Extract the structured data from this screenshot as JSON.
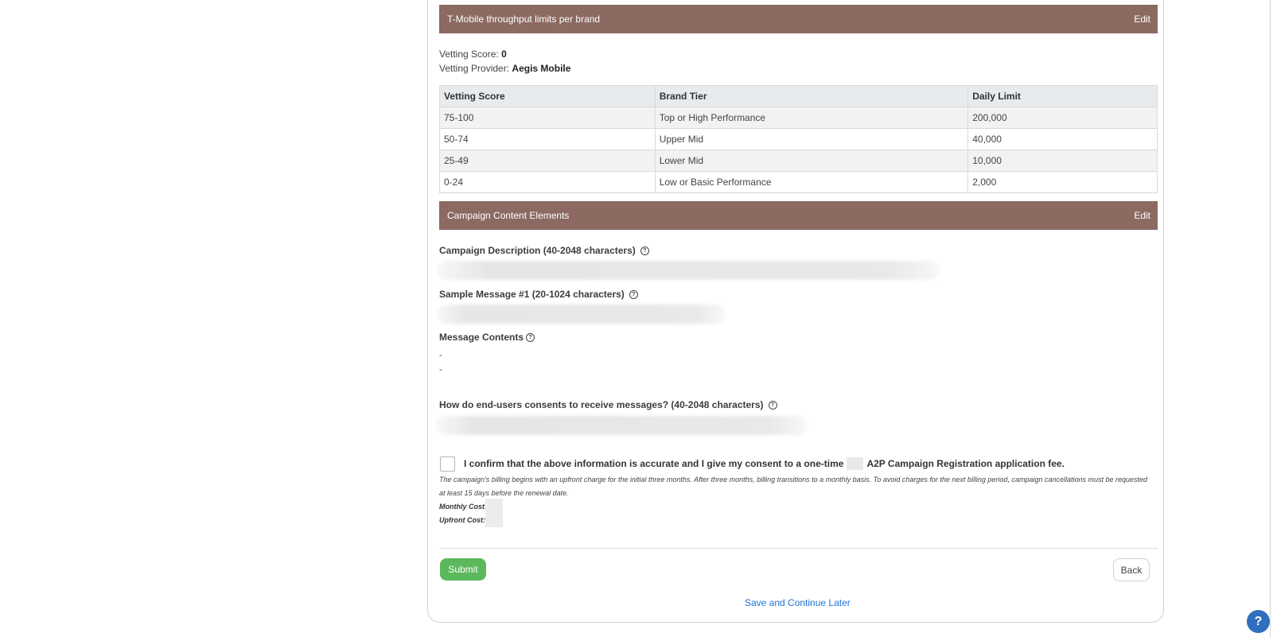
{
  "tmobile": {
    "title": "T-Mobile throughput limits per brand",
    "edit_label": "Edit",
    "vetting_score_label": "Vetting Score:",
    "vetting_score_value": "0",
    "vetting_provider_label": "Vetting Provider:",
    "vetting_provider_value": "Aegis Mobile",
    "columns": [
      "Vetting Score",
      "Brand Tier",
      "Daily Limit"
    ],
    "rows": [
      [
        "75-100",
        "Top or High Performance",
        "200,000"
      ],
      [
        "50-74",
        "Upper Mid",
        "40,000"
      ],
      [
        "25-49",
        "Lower Mid",
        "10,000"
      ],
      [
        "0-24",
        "Low or Basic Performance",
        "2,000"
      ]
    ]
  },
  "content": {
    "title": "Campaign Content Elements",
    "edit_label": "Edit",
    "description_label": "Campaign Description (40-2048 characters)",
    "sample_label": "Sample Message #1 (20-1024 characters)",
    "message_contents_label": "Message Contents",
    "message_contents_items": [
      "-",
      "-"
    ],
    "consent_question_label": "How do end-users consents to receive messages? (40-2048 characters)"
  },
  "confirm": {
    "text_before": "I confirm that the above information is accurate and I give my consent to a one-time",
    "text_after": "A2P Campaign Registration application fee.",
    "billing_note": "The campaign's billing begins with an upfront charge for the initial three months. After three months, billing transitions to a monthly basis. To avoid charges for the next billing period, campaign cancellations must be requested at least 15 days before the renewal date.",
    "monthly_cost_label": "Monthly Cost:",
    "upfront_cost_label": "Upfront Cost:"
  },
  "actions": {
    "submit_label": "Submit",
    "back_label": "Back",
    "save_later_label": "Save and Continue Later"
  },
  "icons": {
    "help": "question-circle-icon",
    "support": "chat-help-icon"
  },
  "colors": {
    "section_bar": "#8c6a61",
    "submit": "#5cb85c",
    "link": "#1e73d8",
    "support_fab": "#2f6fbe"
  }
}
